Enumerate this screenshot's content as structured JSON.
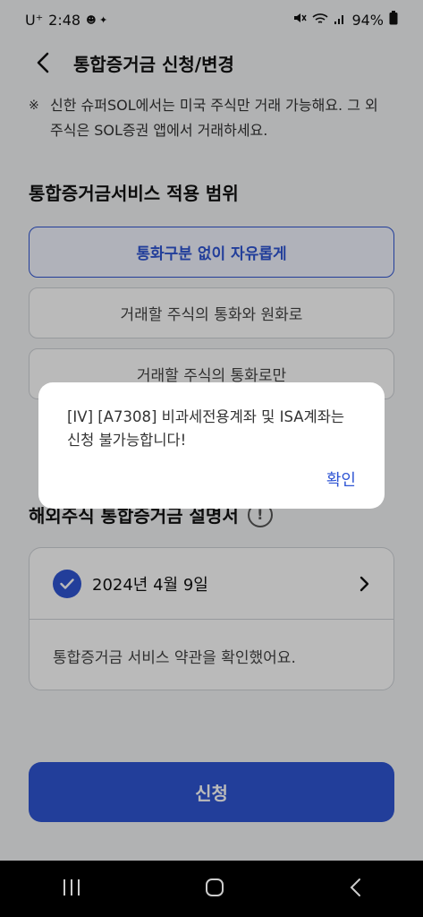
{
  "status_bar": {
    "carrier": "U⁺",
    "time": "2:48",
    "left_icons_text": "☻ ✦",
    "battery": "94%"
  },
  "header": {
    "title": "통합증거금 신청/변경"
  },
  "notice": {
    "mark": "※",
    "text": "신한 슈퍼SOL에서는 미국 주식만 거래 가능해요. 그 외 주식은 SOL증권 앱에서 거래하세요."
  },
  "scope_section": {
    "title": "통합증거금서비스 적용 범위",
    "options": [
      {
        "label": "통화구분 없이 자유롭게",
        "selected": true
      },
      {
        "label": "거래할 주식의 통화와 원화로",
        "selected": false
      },
      {
        "label": "거래할 주식의 통화로만",
        "selected": false
      }
    ]
  },
  "agreement_section": {
    "title": "해외주식 통합증거금 설명서",
    "info_icon_label": "!",
    "date": "2024년 4월 9일",
    "confirm_text": "통합증거금 서비스 약관을 확인했어요."
  },
  "apply_button": {
    "label": "신청"
  },
  "dialog": {
    "message": "[IV] [A7308] 비과세전용계좌 및 ISA계좌는 신청 불가능합니다!",
    "ok_label": "확인"
  },
  "colors": {
    "accent": "#2f55d4",
    "background": "#f3f4f6",
    "nav_bar": "#000000"
  }
}
